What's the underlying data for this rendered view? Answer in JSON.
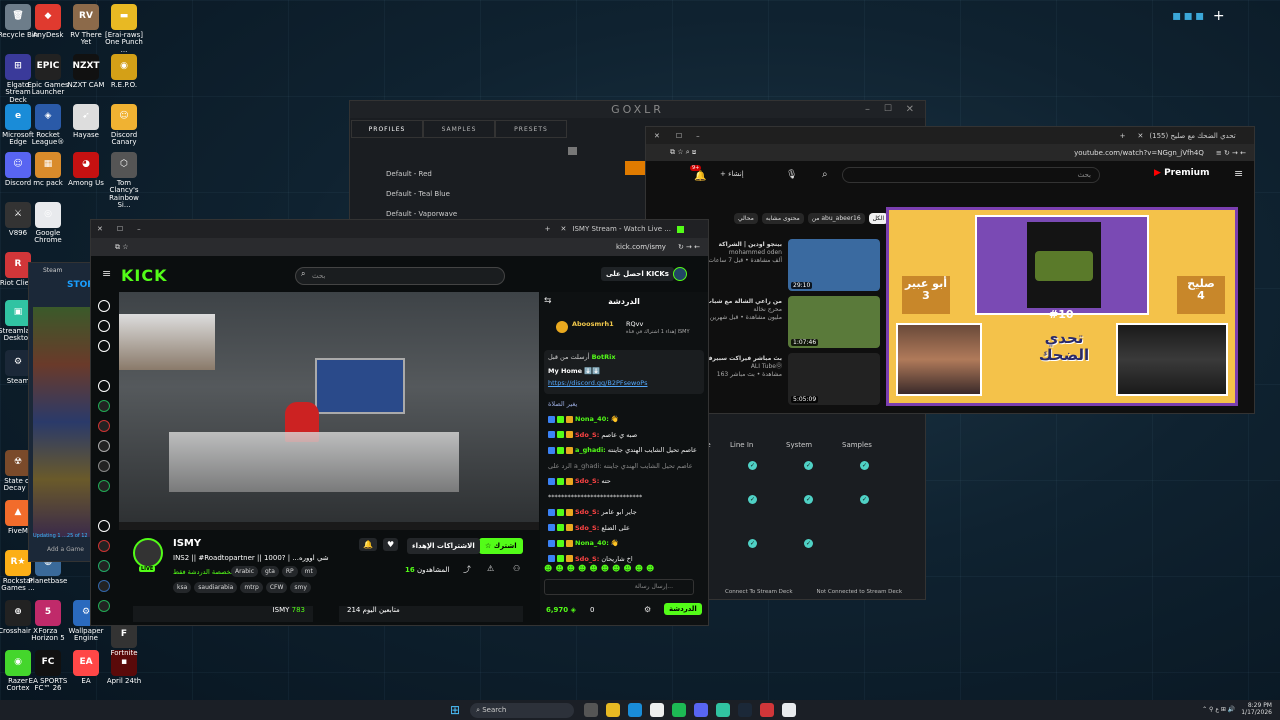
{
  "desktop": {
    "icons": [
      {
        "label": "Recycle Bin",
        "color": "#6d7d8a",
        "glyph": "🗑"
      },
      {
        "label": "AnyDesk",
        "color": "#e03a2f",
        "glyph": "◆"
      },
      {
        "label": "RV There Yet",
        "color": "#8c6a4a",
        "glyph": "RV"
      },
      {
        "label": "[Erai-raws] One Punch ...",
        "color": "#e8b923",
        "glyph": "▬"
      },
      {
        "label": "Elgato Stream Deck",
        "color": "#3a3a9a",
        "glyph": "⊞"
      },
      {
        "label": "Epic Games Launcher",
        "color": "#222",
        "glyph": "EPIC"
      },
      {
        "label": "NZXT CAM",
        "color": "#111",
        "glyph": "NZXT"
      },
      {
        "label": "R.E.P.O.",
        "color": "#d4a017",
        "glyph": "◉"
      },
      {
        "label": "Microsoft Edge",
        "color": "#1a8cd8",
        "glyph": "e"
      },
      {
        "label": "Rocket League®",
        "color": "#2a5aa8",
        "glyph": "◈"
      },
      {
        "label": "Hayase",
        "color": "#ddd",
        "glyph": "➹"
      },
      {
        "label": "Discord Canary",
        "color": "#f0b232",
        "glyph": "☺"
      },
      {
        "label": "Discord",
        "color": "#5865f2",
        "glyph": "☺"
      },
      {
        "label": "mc pack",
        "color": "#d98b2b",
        "glyph": "▦"
      },
      {
        "label": "Among Us",
        "color": "#c51111",
        "glyph": "◕"
      },
      {
        "label": "Tom Clancy's Rainbow Si...",
        "color": "#555",
        "glyph": "⬡"
      },
      {
        "label": "V896",
        "color": "#333",
        "glyph": "⚔"
      },
      {
        "label": "Google Chrome",
        "color": "#e8eaed",
        "glyph": "◎"
      },
      {
        "label": "Riot Client",
        "color": "#d13639",
        "glyph": "R"
      },
      {
        "label": "Streamlabs Desktop",
        "color": "#31c3a2",
        "glyph": "▣"
      },
      {
        "label": "Steam",
        "color": "#1b2838",
        "glyph": "⚙"
      },
      {
        "label": "State of Decay 2",
        "color": "#7a4a2a",
        "glyph": "☢"
      },
      {
        "label": "FiveM",
        "color": "#f26c2b",
        "glyph": "▲"
      },
      {
        "label": "Rockstar Games ...",
        "color": "#fcaf17",
        "glyph": "R★"
      },
      {
        "label": "Planetbase",
        "color": "#3a6a9a",
        "glyph": "◍"
      },
      {
        "label": "Crosshair X",
        "color": "#222",
        "glyph": "⊕"
      },
      {
        "label": "Forza Horizon 5",
        "color": "#c02a6a",
        "glyph": "5"
      },
      {
        "label": "Wallpaper Engine",
        "color": "#2a6abe",
        "glyph": "⚙"
      },
      {
        "label": "Razer Cortex",
        "color": "#44d62c",
        "glyph": "◉"
      },
      {
        "label": "EA SPORTS FC™ 26",
        "color": "#111",
        "glyph": "FC"
      },
      {
        "label": "EA",
        "color": "#ff4747",
        "glyph": "EA"
      },
      {
        "label": "April 24th",
        "color": "#5a0a0a",
        "glyph": "▪"
      },
      {
        "label": "Fortnite",
        "color": "#333",
        "glyph": "F"
      }
    ],
    "steam_fragment": {
      "title": "Steam",
      "store": "STORE",
      "add_game": "Add a Game",
      "updating": "Updating 1 ...25 of 12"
    }
  },
  "goxlr": {
    "title": "GOXLR",
    "tabs": [
      "PROFILES",
      "SAMPLES",
      "PRESETS"
    ],
    "profiles": [
      "Default - Red",
      "Default - Teal Blue",
      "Default - Vaporwave"
    ],
    "routing_headers": [
      "ble",
      "Line In",
      "System",
      "Samples"
    ],
    "status_left": "Connect To Stream Deck",
    "status_right": "Not Connected to Stream Deck",
    "accent": "#e07b00"
  },
  "kick": {
    "tab_title": "ISMY Stream - Watch Live ...",
    "url": "kick.com/ismy",
    "logo": "KICK",
    "search_placeholder": "بحث",
    "get_kicks": "احصل على KICKs",
    "chat_title": "الدردشة",
    "pinned_user": "Aboosmrh1",
    "pinned_to": "RQvv",
    "pinned_text": "إهداء 1 اشتراك في قناة ISMY",
    "pinned_msg_by": "أرسلت من قبل",
    "pinned_author": "BotRix",
    "pinned_body": "My Home ⬇️⬇️",
    "pinned_link": "https://discord.gg/B2PFsewoPs",
    "chat_lines": [
      {
        "user": "",
        "text": "يغير الصلاة",
        "color": "#9ad"
      },
      {
        "user": "Nona_40:",
        "text": "👋",
        "color": "#53fc18"
      },
      {
        "user": "Sdo_S:",
        "text": "صبه ي عاصم",
        "color": "#f44"
      },
      {
        "user": "a_ghadi:",
        "text": "عاصم تحيل الشايب الهندي جاينته",
        "color": "#53fc18"
      },
      {
        "user": "",
        "text": "الرد على a_ghadi: عاصم تحيل الشايب الهندي جاينته",
        "color": "#888"
      },
      {
        "user": "Sdo_S:",
        "text": "حته",
        "color": "#f44"
      },
      {
        "user": "",
        "text": "*****************************",
        "color": "#ddd"
      },
      {
        "user": "Sdo_S:",
        "text": "جاير ابو عامر",
        "color": "#f44"
      },
      {
        "user": "Sdo_S:",
        "text": "على الضلع",
        "color": "#f44"
      },
      {
        "user": "Nona_40:",
        "text": "👋",
        "color": "#53fc18"
      },
      {
        "user": "Sdo_S:",
        "text": "اخ شاريحان",
        "color": "#f44"
      }
    ],
    "chat_input_placeholder": "إرسال رسالة...",
    "kicks_count": "6,970",
    "zero_count": "0",
    "chat_button": "الدردشة",
    "streamer_name": "ISMY",
    "stream_title": "INS2 || #Roadtopartner || 1000? | ...شي اووره",
    "category": "مخصصة الدردشة فقط",
    "live_badge": "LIVE",
    "tags_row1": [
      "Arabic",
      "gta",
      "RP",
      "mt"
    ],
    "tags_row2": [
      "ksa",
      "saudiarabia",
      "mtrp",
      "CFW",
      "smy"
    ],
    "subscribe_btn": "اشترك",
    "gift_subs_btn": "الاشتراكات الإهداء",
    "viewers_label": "المشاهدون",
    "viewers_count": "16",
    "bottom_left": "ISMY",
    "bottom_left_count": "783",
    "bottom_mid": "متابعين اليوم 214"
  },
  "youtube": {
    "tab_title": "(155) تحدي الضحك مع صليح",
    "url": "youtube.com/watch?v=NGgn_jVfh4Q",
    "brand": "Premium",
    "search_placeholder": "بحث",
    "create_btn": "إنشاء",
    "notif_count": "9+",
    "filters": [
      "الكل",
      "من abu_abeer16",
      "محتوى مشابه",
      "محالي"
    ],
    "recs": [
      {
        "title": "بينجو اودين | الشراكة",
        "channel": "mohammed oden",
        "meta": "152 ألف مشاهدة • قبل 7 ساعات",
        "duration": "29:10",
        "thumb": "#3a6aa0"
      },
      {
        "title": "من راعي الشالة مع شباب نوا",
        "channel": "محرج نخالة",
        "meta": "1 مليون مشاهدة • قبل شهرين",
        "duration": "1:07:46",
        "thumb": "#5a7a3a"
      },
      {
        "title": "بث مباشر فيراكت سبيرفر",
        "channel": "ALI TubeⓄ",
        "meta": "163 مشاهدة • بث مباشر",
        "duration": "5:05:09",
        "thumb": "#222"
      }
    ],
    "video_left_name": "أبو عبير",
    "video_left_score": "3",
    "video_right_name": "صليح",
    "video_right_score": "4",
    "video_number": "#10",
    "video_logo_text": "تحدي الضحك"
  },
  "taskbar": {
    "search_label": "Search",
    "time": "8:29 PM",
    "date": "1/17/2026"
  }
}
